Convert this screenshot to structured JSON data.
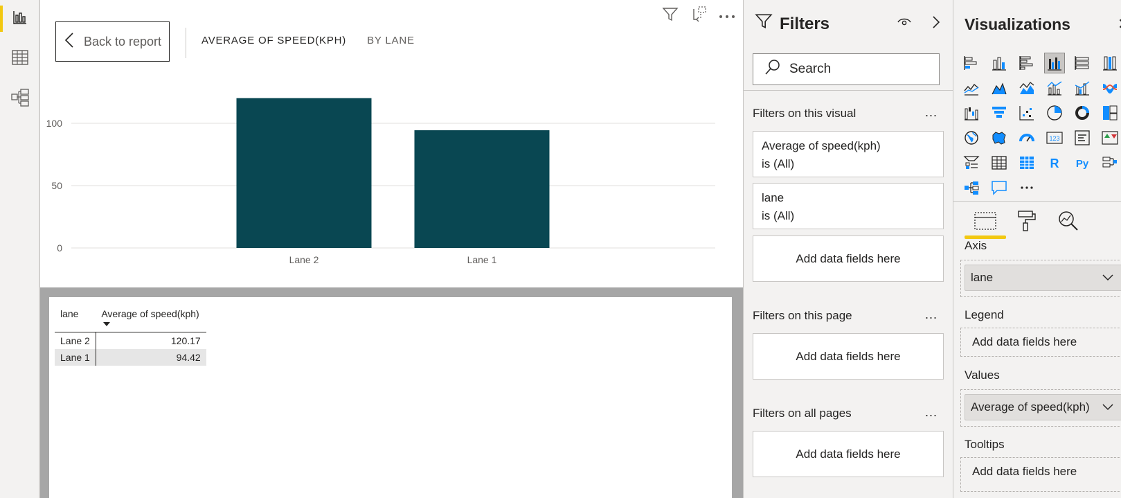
{
  "canvas": {
    "back_label": "Back to report",
    "title_main": "AVERAGE OF SPEED(KPH)",
    "title_sub": "BY LANE"
  },
  "chart_data": {
    "type": "bar",
    "categories": [
      "Lane 2",
      "Lane 1"
    ],
    "values": [
      120.17,
      94.42
    ],
    "ylim": [
      0,
      120
    ],
    "yticks": [
      "0",
      "50",
      "100"
    ],
    "grid": true,
    "bar_color": "#094752"
  },
  "table": {
    "columns": [
      "lane",
      "Average of speed(kph)"
    ],
    "rows": [
      [
        "Lane 2",
        "120.17"
      ],
      [
        "Lane 1",
        "94.42"
      ]
    ]
  },
  "filters": {
    "title": "Filters",
    "search_placeholder": "Search",
    "visual_section": "Filters on this visual",
    "page_section": "Filters on this page",
    "all_section": "Filters on all pages",
    "dots": "...",
    "cards": [
      {
        "line1": "Average of speed(kph)",
        "line2": "is (All)"
      },
      {
        "line1": "lane",
        "line2": "is (All)"
      }
    ],
    "add_label": "Add data fields here"
  },
  "viz": {
    "title": "Visualizations",
    "more": "...",
    "icons": [
      "stacked-bar-icon",
      "stacked-column-icon",
      "clustered-bar-icon",
      "clustered-column-icon",
      "100-bar-icon",
      "100-column-icon",
      "line-chart-icon",
      "area-chart-icon",
      "stacked-area-icon",
      "line-column-icon",
      "line-clustered-column-icon",
      "ribbon-chart-icon",
      "waterfall-icon",
      "funnel-icon",
      "scatter-icon",
      "pie-chart-icon",
      "donut-chart-icon",
      "treemap-icon",
      "map-icon",
      "filled-map-icon",
      "gauge-icon",
      "card-icon",
      "multirow-card-icon",
      "kpi-icon",
      "slicer-icon",
      "table-icon",
      "matrix-icon",
      "r-visual-icon",
      "python-visual-icon",
      "key-influencers-icon",
      "decomposition-tree-icon",
      "qa-icon",
      "more-visuals-icon"
    ],
    "r_text": "R",
    "py_text": "Py",
    "card_text": "123",
    "wells": [
      {
        "label": "Axis",
        "value": "lane"
      },
      {
        "label": "Legend",
        "value": ""
      },
      {
        "label": "Values",
        "value": "Average of speed(kph)"
      },
      {
        "label": "Tooltips",
        "value": ""
      }
    ],
    "add_label": "Add data fields here"
  },
  "colors": {
    "accent": "#f2c811",
    "bar": "#094752",
    "viz_blue": "#118dff"
  }
}
